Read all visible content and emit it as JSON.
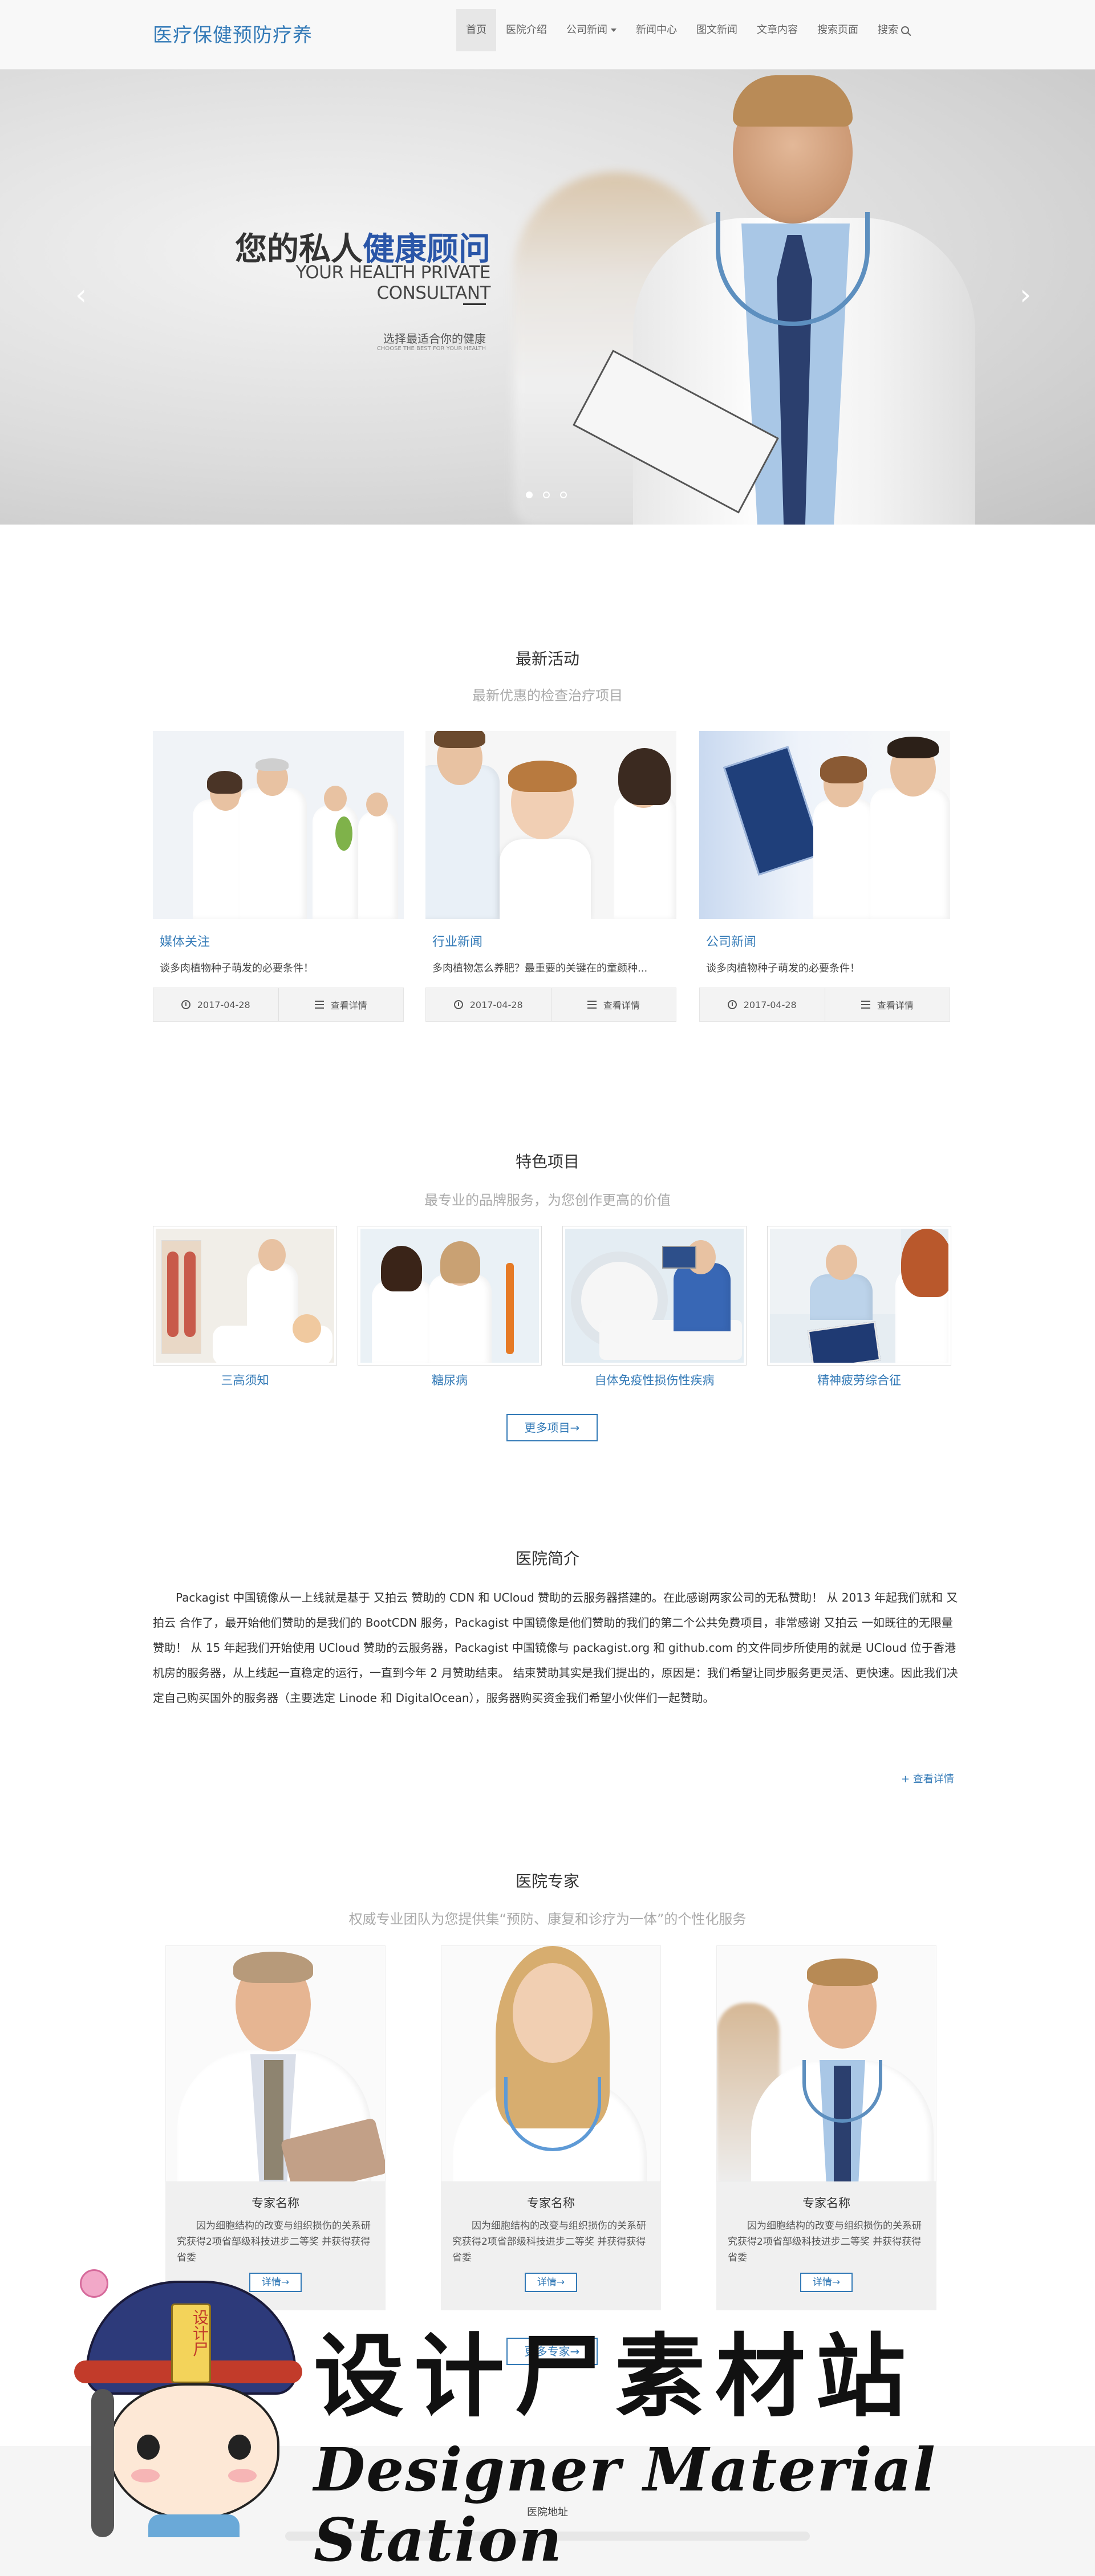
{
  "nav": {
    "brand": "医疗保健预防疗养",
    "items": [
      {
        "label": "首页",
        "active": true
      },
      {
        "label": "医院介绍"
      },
      {
        "label": "公司新闻",
        "dropdown": true
      },
      {
        "label": "新闻中心"
      },
      {
        "label": "图文新闻"
      },
      {
        "label": "文章内容"
      },
      {
        "label": "搜索页面"
      },
      {
        "label": "搜索",
        "icon": "search-icon"
      }
    ]
  },
  "hero": {
    "title_part1": "您的私人",
    "title_part2": "健康顾问",
    "subtitle_en": "YOUR HEALTH PRIVATE CONSULTANT",
    "tagline": "选择最适合你的健康",
    "tagline_en": "CHOOSE THE BEST FOR YOUR HEALTH",
    "prev_icon": "‹",
    "next_icon": "›",
    "slides": 3,
    "active_slide": 1
  },
  "activities": {
    "title": "最新活动",
    "subtitle": "最新优惠的检查治疗项目",
    "cards": [
      {
        "category": "媒体关注",
        "desc": "谈多肉植物种子萌发的必要条件！",
        "date": "2017-04-28",
        "more": "查看详情"
      },
      {
        "category": "行业新闻",
        "desc": "多肉植物怎么养肥？最重要的关键在的童颜种...",
        "date": "2017-04-28",
        "more": "查看详情"
      },
      {
        "category": "公司新闻",
        "desc": "谈多肉植物种子萌发的必要条件！",
        "date": "2017-04-28",
        "more": "查看详情"
      }
    ]
  },
  "featured": {
    "title": "特色项目",
    "subtitle": "最专业的品牌服务，为您创作更高的价值",
    "items": [
      {
        "caption": "三高须知"
      },
      {
        "caption": "糖尿病"
      },
      {
        "caption": "自体免疫性损伤性疾病"
      },
      {
        "caption": "精神疲劳综合征"
      }
    ],
    "more_button": "更多项目→"
  },
  "about": {
    "title": "医院简介",
    "text": "Packagist 中国镜像从一上线就是基于 又拍云 赞助的 CDN 和 UCloud 赞助的云服务器搭建的。在此感谢两家公司的无私赞助！ 从 2013 年起我们就和 又拍云 合作了，最开始他们赞助的是我们的 BootCDN 服务，Packagist 中国镜像是他们赞助的我们的第二个公共免费项目，非常感谢 又拍云 一如既往的无限量赞助！ 从 15 年起我们开始使用 UCloud 赞助的云服务器，Packagist 中国镜像与 packagist.org 和 github.com 的文件同步所使用的就是 UCloud 位于香港机房的服务器，从上线起一直稳定的运行，一直到今年 2 月赞助结束。 结束赞助其实是我们提出的，原因是：我们希望让同步服务更灵活、更快速。因此我们决定自己购买国外的服务器（主要选定 Linode 和 DigitalOcean），服务器购买资金我们希望小伙伴们一起赞助。",
    "more": "+ 查看详情"
  },
  "experts": {
    "title": "医院专家",
    "subtitle": "权威专业团队为您提供集“预防、康复和诊疗为一体”的个性化服务",
    "items": [
      {
        "name": "专家名称",
        "desc": "因为细胞结构的改变与组织损伤的关系研究获得2项省部级科技进步二等奖 并获得获得省委",
        "button": "详情→"
      },
      {
        "name": "专家名称",
        "desc": "因为细胞结构的改变与组织损伤的关系研究获得2项省部级科技进步二等奖 并获得获得省委",
        "button": "详情→"
      },
      {
        "name": "专家名称",
        "desc": "因为细胞结构的改变与组织损伤的关系研究获得2项省部级科技进步二等奖 并获得获得省委",
        "button": "详情→"
      }
    ],
    "more_button": "更多专家→"
  },
  "footer": {
    "address_label": "医院地址"
  },
  "watermark": {
    "badge_text": "设计尸",
    "cn": "设计尸素材站",
    "en": "Designer Material Station"
  },
  "colors": {
    "accent": "#337ab7",
    "hero_title_highlight": "#2a56a8",
    "nav_bg": "#f8f8f8"
  }
}
